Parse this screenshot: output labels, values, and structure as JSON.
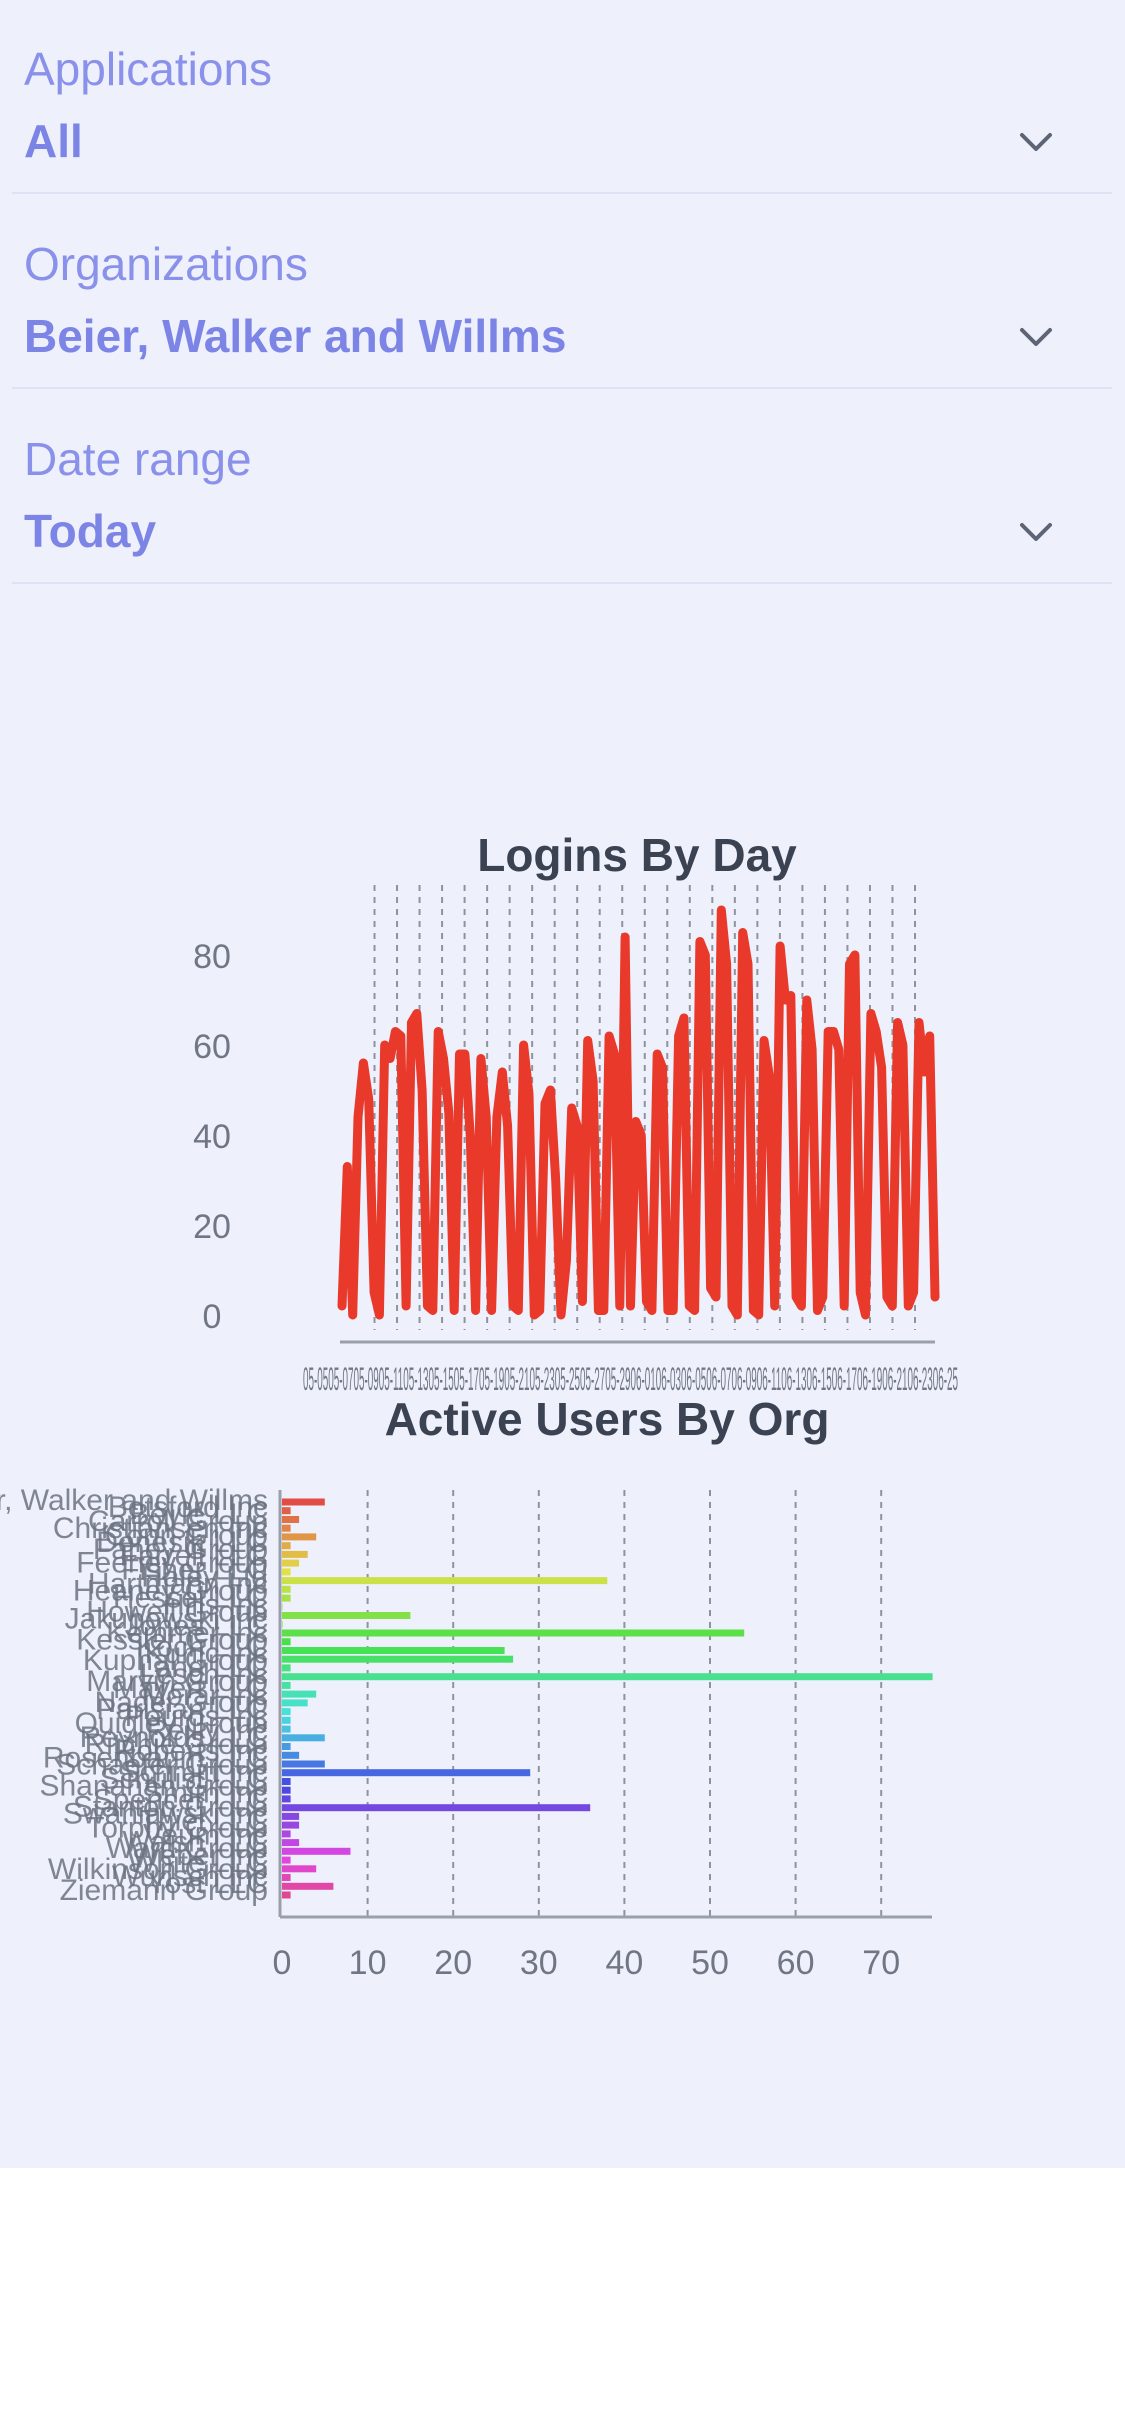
{
  "filters": [
    {
      "label": "Applications",
      "value": "All"
    },
    {
      "label": "Organizations",
      "value": "Beier, Walker and Willms"
    },
    {
      "label": "Date range",
      "value": "Today"
    }
  ],
  "chart_data": [
    {
      "type": "line",
      "title": "Logins By Day",
      "xlabel": "",
      "ylabel": "",
      "ylim": [
        0,
        90
      ],
      "yticks": [
        0,
        20,
        40,
        60,
        80
      ],
      "x_tick_labels": [
        "05-05",
        "05-07",
        "05-09",
        "05-11",
        "05-13",
        "05-15",
        "05-17",
        "05-19",
        "05-21",
        "05-23",
        "05-25",
        "05-27",
        "05-29",
        "06-01",
        "06-03",
        "06-05",
        "06-07",
        "06-09",
        "06-11",
        "06-13",
        "06-15",
        "06-17",
        "06-19",
        "06-21",
        "06-23",
        "06-25"
      ],
      "x_tick_label_overlap": "05-0505-0705-0905-1105-1305-1505-1705-1905-2105-2305-2505-2705-2906-0106-0306-0506-0706-0906-1106-1306-1506-1706-1906-2106-2306-25",
      "grid": "vertical-dashed",
      "color": "#e8392a",
      "values": [
        2,
        33,
        0,
        44,
        56,
        48,
        5,
        0,
        60,
        57,
        63,
        62,
        2,
        65,
        67,
        50,
        2,
        1,
        63,
        57,
        45,
        1,
        58,
        58,
        40,
        1,
        57,
        44,
        1,
        44,
        54,
        42,
        2,
        1,
        60,
        49,
        0,
        1,
        47,
        50,
        30,
        0,
        12,
        46,
        42,
        3,
        61,
        52,
        1,
        1,
        62,
        58,
        2,
        84,
        2,
        43,
        40,
        3,
        1,
        58,
        55,
        1,
        1,
        62,
        66,
        2,
        1,
        83,
        80,
        6,
        4,
        90,
        78,
        2,
        0,
        85,
        78,
        1,
        0,
        61,
        53,
        2,
        82,
        70,
        71,
        4,
        2,
        70,
        59,
        1,
        4,
        63,
        63,
        59,
        2,
        78,
        80,
        5,
        0,
        67,
        63,
        55,
        4,
        2,
        65,
        60,
        2,
        5,
        65,
        54,
        62,
        4
      ]
    },
    {
      "type": "bar",
      "orientation": "horizontal",
      "title": "Active Users By Org",
      "xlabel": "",
      "ylabel": "",
      "xlim": [
        0,
        76
      ],
      "xticks": [
        0,
        10,
        20,
        30,
        40,
        50,
        60,
        70
      ],
      "grid": "vertical-dashed",
      "categories": [
        "Beier, Walker and Willms",
        "Botsford Inc",
        "Boyle LLC",
        "Carroll Group",
        "Christiansen Inc",
        "Conn Group",
        "Denesik LLC",
        "Fahey Group",
        "Farrell LLC",
        "Feeney Group",
        "Fisher LLC",
        "Haley Ltd",
        "Hartmann Inc",
        "Heaney Group",
        "Hessel LLC",
        "Hills Inc",
        "Howell Group",
        "Jakubowski Inc",
        "Jones LLC",
        "Kemmer Inc",
        "Kessler Group",
        "Koch LLC",
        "Kuhic Inc",
        "Kuphal Group",
        "Lang LLC",
        "Lesch Inc",
        "Marvin Group",
        "Mayert LLC",
        "Morar Inc",
        "Nader Group",
        "Parisian LLC",
        "Pouros Inc",
        "Quigley Group",
        "Reilly Inc",
        "Reynolds LLC",
        "Ritchie Group",
        "Roberts Inc",
        "Rosenbaum LLC",
        "Schaefer Group",
        "Schmitt Inc",
        "Schulist LLC",
        "Shanahan Group",
        "Smith Inc",
        "Spencer LLC",
        "Stanton Group",
        "Swaniawski Inc",
        "Thiel LLC",
        "Torphy Group",
        "Veum Inc",
        "Walsh LLC",
        "Ward Group",
        "Weber Inc",
        "White LLC",
        "Wilkinson Group",
        "Wunsch Inc",
        "Yost LLC",
        "Ziemann Group"
      ],
      "values": [
        5,
        1,
        2,
        1,
        4,
        1,
        3,
        2,
        1,
        38,
        1,
        1,
        0,
        15,
        0,
        54,
        1,
        26,
        27,
        1,
        76,
        1,
        4,
        3,
        1,
        1,
        1,
        5,
        1,
        2,
        5,
        29,
        1,
        1,
        1,
        36,
        2,
        2,
        1,
        2,
        8,
        1,
        4,
        1,
        6,
        1
      ]
    }
  ]
}
